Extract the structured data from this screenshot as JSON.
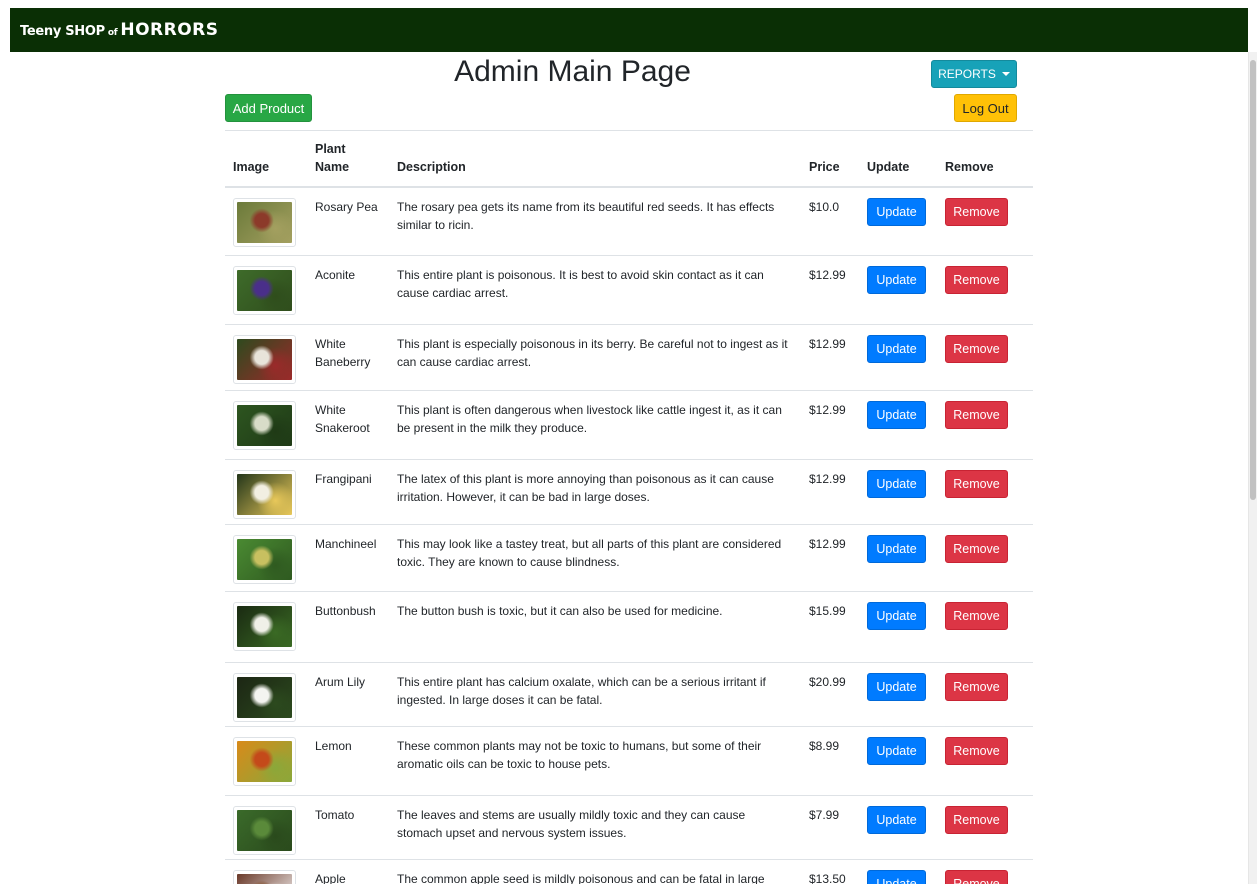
{
  "nav": {
    "brand_part1": "Teeny SHOP",
    "brand_part2": "of",
    "brand_part3": "HORRORS"
  },
  "header": {
    "title": "Admin Main Page",
    "reports_label": "REPORTS",
    "add_product_label": "Add Product",
    "logout_label": "Log Out"
  },
  "table": {
    "columns": [
      "Image",
      "Plant Name",
      "Description",
      "Price",
      "Update",
      "Remove"
    ],
    "update_label": "Update",
    "remove_label": "Remove",
    "rows": [
      {
        "name": "Rosary Pea",
        "description": "The rosary pea gets its name from its beautiful red seeds. It has effects similar to ricin.",
        "price": "$10.0",
        "image_colors": [
          "#6b7a3a",
          "#8c3a2a",
          "#a4a060"
        ]
      },
      {
        "name": "Aconite",
        "description": "This entire plant is poisonous. It is best to avoid skin contact as it can cause cardiac arrest.",
        "price": "$12.99",
        "image_colors": [
          "#3e6b2a",
          "#4a2f8a",
          "#2f4d1c"
        ]
      },
      {
        "name": "White Baneberry",
        "description": "This plant is especially poisonous in its berry. Be careful not to ingest as it can cause cardiac arrest.",
        "price": "$12.99",
        "image_colors": [
          "#2e4a1e",
          "#e8e4da",
          "#9b2a2a"
        ]
      },
      {
        "name": "White Snakeroot",
        "description": "This plant is often dangerous when livestock like cattle ingest it, as it can be present in the milk they produce.",
        "price": "$12.99",
        "image_colors": [
          "#2d5520",
          "#d8dcc8",
          "#1f3a16"
        ]
      },
      {
        "name": "Frangipani",
        "description": "The latex of this plant is more annoying than poisonous as it can cause irritation. However, it can be bad in large doses.",
        "price": "$12.99",
        "image_colors": [
          "#23361a",
          "#f2efe2",
          "#e8c85a"
        ]
      },
      {
        "name": "Manchineel",
        "description": "This may look like a tastey treat, but all parts of this plant are considered toxic. They are known to cause blindness.",
        "price": "$12.99",
        "image_colors": [
          "#4a8a32",
          "#c8c060",
          "#2f5a20"
        ]
      },
      {
        "name": "Buttonbush",
        "description": "The button bush is toxic, but it can also be used for medicine.",
        "price": "$15.99",
        "image_colors": [
          "#1a2a12",
          "#f0f0e8",
          "#3a6a24"
        ]
      },
      {
        "name": "Arum Lily",
        "description": "This entire plant has calcium oxalate, which can be a serious irritant if ingested. In large doses it can be fatal.",
        "price": "$20.99",
        "image_colors": [
          "#1c2614",
          "#f4f4f0",
          "#2c4a1e"
        ]
      },
      {
        "name": "Lemon",
        "description": "These common plants may not be toxic to humans, but some of their aromatic oils can be toxic to house pets.",
        "price": "$8.99",
        "image_colors": [
          "#d88a1a",
          "#c44a1a",
          "#8aa83a"
        ]
      },
      {
        "name": "Tomato",
        "description": "The leaves and stems are usually mildly toxic and they can cause stomach upset and nervous system issues.",
        "price": "$7.99",
        "image_colors": [
          "#3a6a2a",
          "#5a8a3a",
          "#2a4a1c"
        ]
      },
      {
        "name": "Apple",
        "description": "The common apple seed is mildly poisonous and can be fatal in large",
        "price": "$13.50",
        "image_colors": [
          "#6a3a2a",
          "#8a5a3a",
          "#ffffff"
        ]
      }
    ]
  }
}
